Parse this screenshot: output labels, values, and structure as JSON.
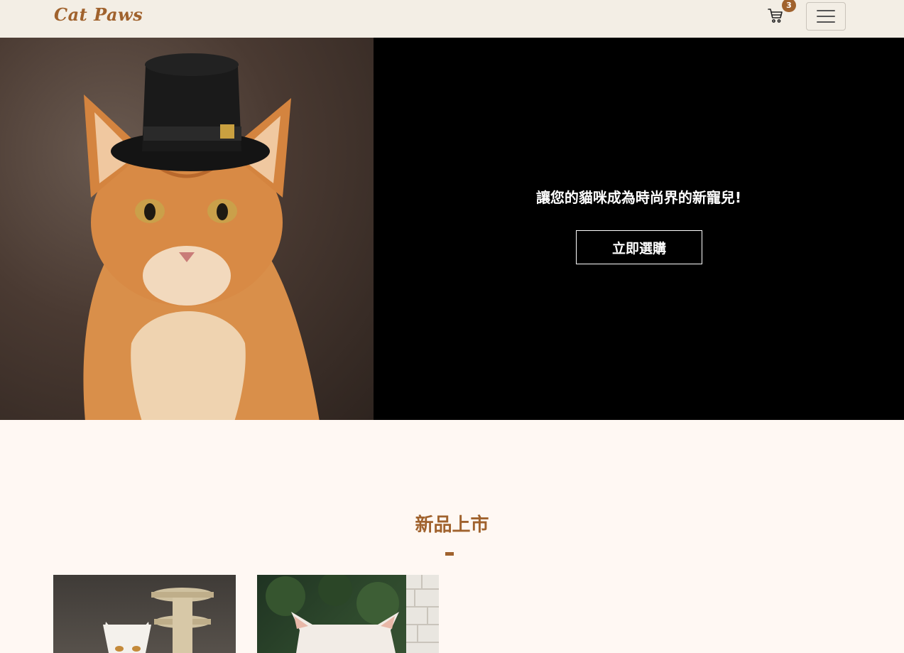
{
  "navbar": {
    "brand": "Cat Paws",
    "cart_count": "3",
    "cart_icon": "cart-icon",
    "menu_icon": "hamburger-icon"
  },
  "hero": {
    "tagline": "讓您的貓咪成為時尚界的新寵兒!",
    "cta_label": "立即選購",
    "image_subject": "ginger cat wearing black top hat"
  },
  "new_arrivals": {
    "title": "新品上市",
    "products": [
      {
        "image_subject": "white cat beside cat scratching post"
      },
      {
        "image_subject": "white cat in front of greenery and brick wall"
      }
    ]
  },
  "colors": {
    "brand": "#a0622d",
    "navbar_bg": "#f3eee5",
    "page_bg": "#fff8f3",
    "hero_bg": "#000000"
  }
}
